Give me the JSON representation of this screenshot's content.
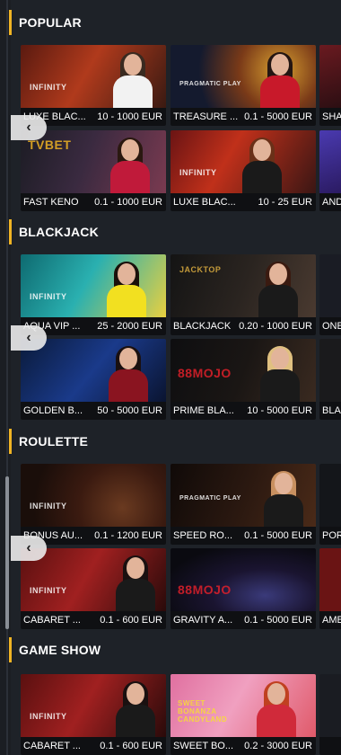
{
  "sections": [
    {
      "title": "POPULAR",
      "tiles": [
        {
          "name": "LUXE BLAC...",
          "limit": "10 - 1000 EUR",
          "brand": "INFINITY"
        },
        {
          "name": "TREASURE ...",
          "limit": "0.1 - 5000 EUR",
          "brand": "PRAGMATIC PLAY"
        },
        {
          "name": "SHA",
          "limit": ""
        },
        {
          "name": "FAST KENO",
          "limit": "0.1 - 1000 EUR",
          "brand": "TVBET"
        },
        {
          "name": "LUXE BLAC...",
          "limit": "10 - 25 EUR",
          "brand": "INFINITY"
        },
        {
          "name": "AND",
          "limit": ""
        }
      ]
    },
    {
      "title": "BLACKJACK",
      "tiles": [
        {
          "name": "AQUA VIP ...",
          "limit": "25 - 2000 EUR",
          "brand": "INFINITY"
        },
        {
          "name": "BLACKJACK",
          "limit": "0.20 - 1000 EUR",
          "brand": "JACKTOP"
        },
        {
          "name": "ONE",
          "limit": ""
        },
        {
          "name": "GOLDEN B...",
          "limit": "50 - 5000 EUR",
          "brand": ""
        },
        {
          "name": "PRIME BLA...",
          "limit": "10 - 5000 EUR",
          "brand": "88MOJO"
        },
        {
          "name": "BLA",
          "limit": ""
        }
      ]
    },
    {
      "title": "ROULETTE",
      "tiles": [
        {
          "name": "BONUS AU...",
          "limit": "0.1 - 1200 EUR",
          "brand": "INFINITY"
        },
        {
          "name": "SPEED RO...",
          "limit": "0.1 - 5000 EUR",
          "brand": "PRAGMATIC PLAY"
        },
        {
          "name": "POR",
          "limit": ""
        },
        {
          "name": "CABARET ...",
          "limit": "0.1 - 600 EUR",
          "brand": "INFINITY"
        },
        {
          "name": "GRAVITY A...",
          "limit": "0.1 - 5000 EUR",
          "brand": "88MOJO"
        },
        {
          "name": "AME",
          "limit": ""
        }
      ]
    },
    {
      "title": "GAME SHOW",
      "tiles": [
        {
          "name": "CABARET ...",
          "limit": "0.1 - 600 EUR",
          "brand": "INFINITY"
        },
        {
          "name": "SWEET BO...",
          "limit": "0.2 - 3000 EUR",
          "brand": "SWEET BONANZA CANDYLAND"
        },
        {
          "name": "",
          "limit": ""
        }
      ]
    }
  ],
  "nav": {
    "prev_glyph": "‹"
  },
  "colors": {
    "accent": "#f0b424",
    "background": "#1e2228",
    "caption_bg": "#0f1013"
  }
}
